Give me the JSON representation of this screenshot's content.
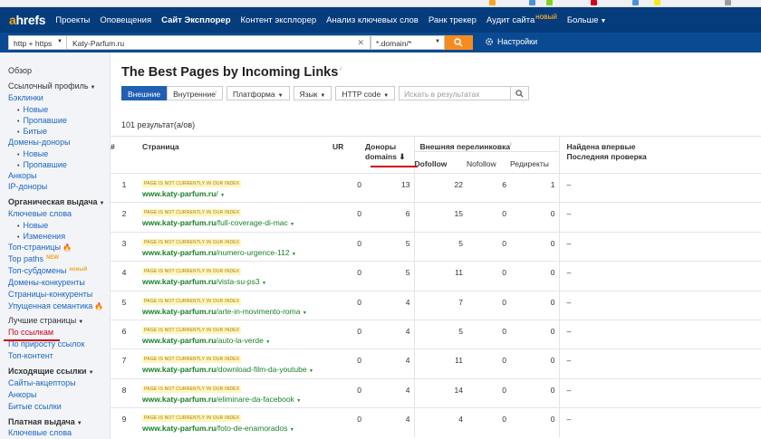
{
  "nav": {
    "logo_a": "a",
    "logo_rest": "hrefs",
    "items": [
      {
        "label": "Проекты"
      },
      {
        "label": "Оповещения"
      },
      {
        "label": "Сайт Эксплорер"
      },
      {
        "label": "Контент эксплорер"
      },
      {
        "label": "Анализ ключевых слов"
      },
      {
        "label": "Ранк трекер"
      },
      {
        "label": "Аудит сайта",
        "badge": "НОВЫЙ"
      },
      {
        "label": "Больше"
      }
    ]
  },
  "search": {
    "protocol": "http + https",
    "url": "Katy-Parfum.ru",
    "mode": "*.domain/*",
    "settings_label": "Настройки"
  },
  "sidebar": {
    "overview": "Обзор",
    "link_profile": "Ссылочный профиль",
    "backlinks": "Бэклинки",
    "backlinks_new": "Новые",
    "backlinks_lost": "Пропавшие",
    "backlinks_broken": "Битые",
    "ref_domains": "Домены-доноры",
    "ref_new": "Новые",
    "ref_lost": "Пропавшие",
    "anchors": "Анкоры",
    "ip_donors": "IP-доноры",
    "organic": "Органическая выдача",
    "keywords": "Ключевые слова",
    "kw_new": "Новые",
    "kw_changes": "Изменения",
    "top_pages": "Топ-страницы",
    "top_paths": "Top paths",
    "top_paths_badge": "NEW",
    "top_subdomains": "Топ-субдомены",
    "top_subdomains_badge": "новый",
    "competing_domains": "Домены-конкуренты",
    "competing_pages": "Страницы-конкуренты",
    "content_gap": "Упущенная семантика",
    "best_pages": "Лучшие страницы",
    "by_links": "По ссылкам",
    "by_link_growth": "По приросту ссылок",
    "top_content": "Топ-контент",
    "outgoing": "Исходящие ссылки",
    "linked_domains": "Сайты-акцепторы",
    "out_anchors": "Анкоры",
    "broken_links": "Битые ссылки",
    "paid": "Платная выдача",
    "ppc_keywords": "Ключевые слова"
  },
  "main": {
    "title": "The Best Pages by Incoming Links",
    "title_sup": "i",
    "filters": {
      "external": "Внешние",
      "internal": "Внутренние",
      "platform": "Платформа",
      "language": "Язык",
      "http_code": "HTTP code",
      "search_placeholder": "Искать в результатах"
    },
    "results_count": "101 результат(а/ов)",
    "columns": {
      "num": "#",
      "page": "Страница",
      "ur": "UR",
      "donors_line1": "Доноры",
      "donors_line2": "domains",
      "sort_arrow": "⬇",
      "external_links": "Внешняя перелинковка",
      "dofollow": "Dofollow",
      "nofollow": "Nofollow",
      "redirects": "Редиректы",
      "first_seen": "Найдена впервые",
      "last_check": "Последняя проверка"
    },
    "rows": [
      {
        "n": "1",
        "badge": "PAGE IS NOT CURRENTLY IN OUR INDEX",
        "domain": "www.katy-parfum.ru",
        "path": "/",
        "ur": "0",
        "domains": "13",
        "dofollow": "22",
        "nofollow": "6",
        "redirects": "1",
        "dash": "–"
      },
      {
        "n": "2",
        "badge": "PAGE IS NOT CURRENTLY IN OUR INDEX",
        "domain": "www.katy-parfum.ru",
        "path": "/full-coverage-di-mac",
        "ur": "0",
        "domains": "6",
        "dofollow": "15",
        "nofollow": "0",
        "redirects": "0",
        "dash": "–"
      },
      {
        "n": "3",
        "badge": "PAGE IS NOT CURRENTLY IN OUR INDEX",
        "domain": "www.katy-parfum.ru",
        "path": "/numero-urgence-112",
        "ur": "0",
        "domains": "5",
        "dofollow": "5",
        "nofollow": "0",
        "redirects": "0",
        "dash": "–"
      },
      {
        "n": "4",
        "badge": "PAGE IS NOT CURRENTLY IN OUR INDEX",
        "domain": "www.katy-parfum.ru",
        "path": "/vista-su-ps3",
        "ur": "0",
        "domains": "5",
        "dofollow": "11",
        "nofollow": "0",
        "redirects": "0",
        "dash": "–"
      },
      {
        "n": "5",
        "badge": "PAGE IS NOT CURRENTLY IN OUR INDEX",
        "domain": "www.katy-parfum.ru",
        "path": "/arte-in-movimento-roma",
        "ur": "0",
        "domains": "4",
        "dofollow": "7",
        "nofollow": "0",
        "redirects": "0",
        "dash": "–"
      },
      {
        "n": "6",
        "badge": "PAGE IS NOT CURRENTLY IN OUR INDEX",
        "domain": "www.katy-parfum.ru",
        "path": "/auto-la-verde",
        "ur": "0",
        "domains": "4",
        "dofollow": "5",
        "nofollow": "0",
        "redirects": "0",
        "dash": "–"
      },
      {
        "n": "7",
        "badge": "PAGE IS NOT CURRENTLY IN OUR INDEX",
        "domain": "www.katy-parfum.ru",
        "path": "/download-film-da-youtube",
        "ur": "0",
        "domains": "4",
        "dofollow": "11",
        "nofollow": "0",
        "redirects": "0",
        "dash": "–"
      },
      {
        "n": "8",
        "badge": "PAGE IS NOT CURRENTLY IN OUR INDEX",
        "domain": "www.katy-parfum.ru",
        "path": "/eliminare-da-facebook",
        "ur": "0",
        "domains": "4",
        "dofollow": "14",
        "nofollow": "0",
        "redirects": "0",
        "dash": "–"
      },
      {
        "n": "9",
        "badge": "PAGE IS NOT CURRENTLY IN OUR INDEX",
        "domain": "www.katy-parfum.ru",
        "path": "/foto-de-enamorados",
        "ur": "0",
        "domains": "4",
        "dofollow": "4",
        "nofollow": "0",
        "redirects": "0",
        "dash": "–"
      }
    ]
  },
  "colors": {
    "nav_bg": "#053C7C",
    "accent_orange": "#F78C1E",
    "link_blue": "#1E66C1",
    "url_green": "#1a7f2a",
    "annotation_red": "#D0021B"
  }
}
